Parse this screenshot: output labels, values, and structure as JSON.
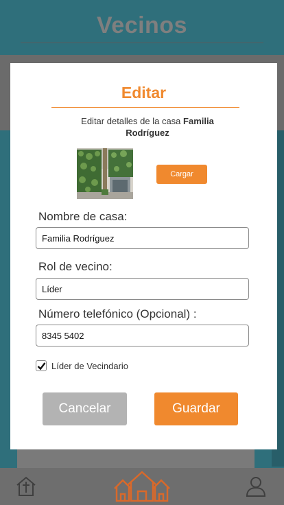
{
  "app": {
    "title": "Vecinos"
  },
  "modal": {
    "title": "Editar",
    "subtitle_prefix": "Editar detalles de la casa ",
    "subtitle_house": "Familia Rodríguez",
    "upload_label": "Cargar",
    "fields": {
      "house_name": {
        "label": "Nombre de casa:",
        "value": "Familia Rodríguez"
      },
      "role": {
        "label": "Rol de vecino:",
        "value": "Líder"
      },
      "phone": {
        "label": "Número telefónico (Opcional) :",
        "value": "8345 5402"
      }
    },
    "leader_checkbox": {
      "label": "Líder de Vecindario",
      "checked": true
    },
    "cancel_label": "Cancelar",
    "save_label": "Guardar"
  },
  "colors": {
    "accent": "#f0892e",
    "teal": "#2f6f7b",
    "cancel": "#b3b3b3"
  },
  "nav": {
    "items": [
      "church-icon",
      "neighborhood-icon",
      "profile-icon"
    ]
  }
}
